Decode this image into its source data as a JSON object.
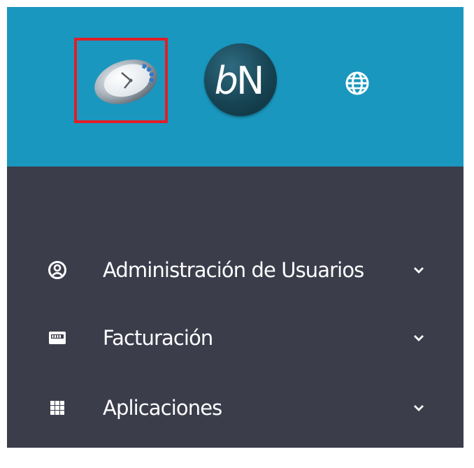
{
  "header": {
    "logos": [
      {
        "name": "clock-logo",
        "icon": "clock-icon",
        "selected": true
      },
      {
        "name": "bn-logo",
        "text": "bN"
      }
    ],
    "language_icon": "globe-icon"
  },
  "menu": {
    "items": [
      {
        "label": "Administración de Usuarios",
        "icon": "user-circle-icon",
        "expand_icon": "chevron-down-icon"
      },
      {
        "label": "Facturación",
        "icon": "invoice-icon",
        "expand_icon": "chevron-down-icon"
      },
      {
        "label": "Aplicaciones",
        "icon": "apps-grid-icon",
        "expand_icon": "chevron-down-icon"
      }
    ]
  },
  "colors": {
    "header_bg": "#1a97bf",
    "sidebar_bg": "#3b3d4b",
    "highlight_border": "#e01e26",
    "text": "#ffffff"
  }
}
